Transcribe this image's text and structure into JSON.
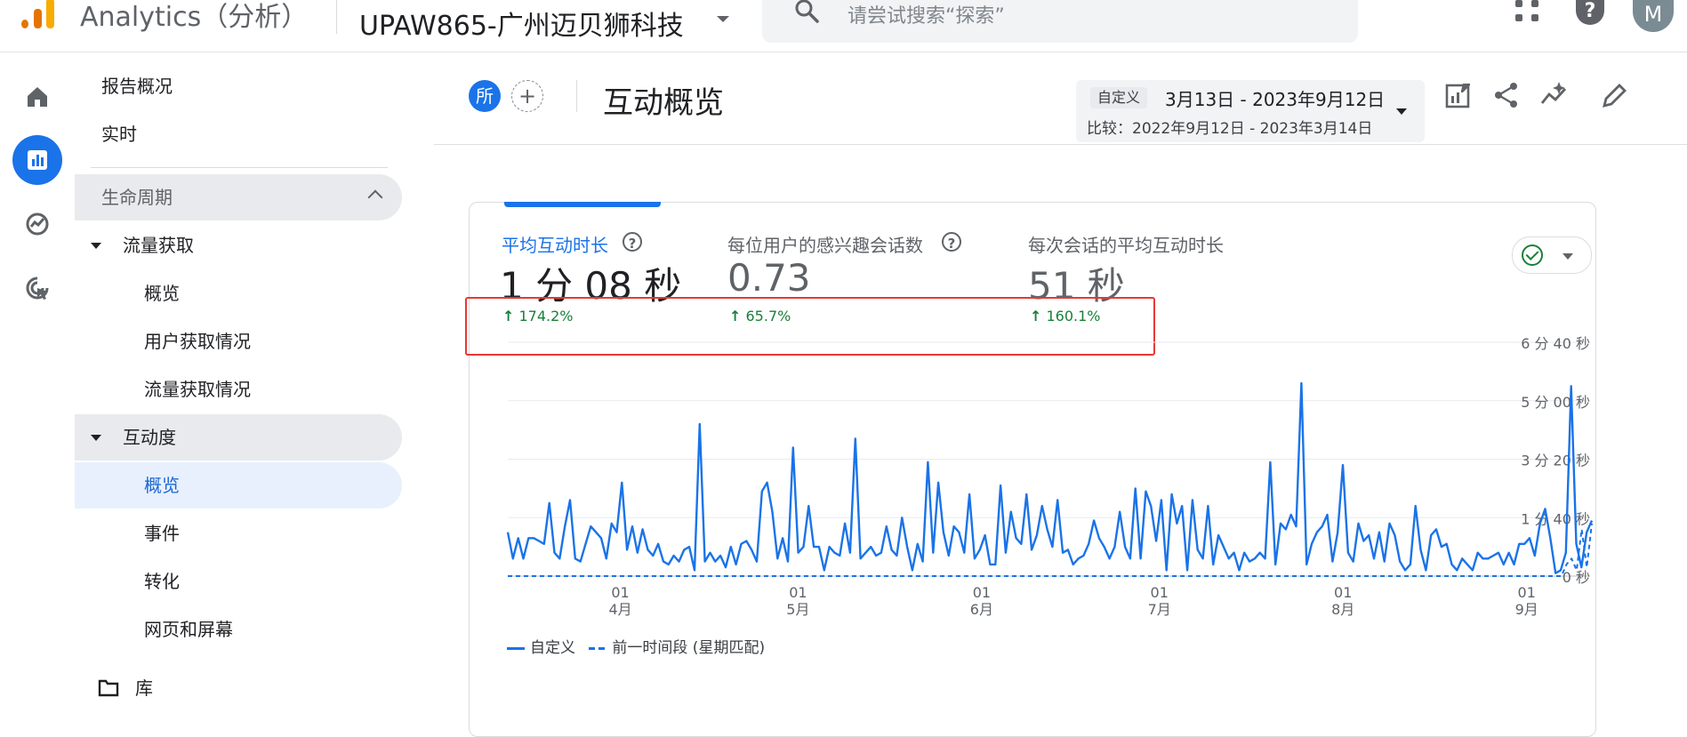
{
  "topbar": {
    "product": "Analytics（分析）",
    "account": "UPAW865-广州迈贝狮科技",
    "search_placeholder": "请尝试搜索“探索”",
    "help": "?",
    "avatar": "M"
  },
  "rail": {
    "items": [
      {
        "icon": "home-icon",
        "active": false
      },
      {
        "icon": "reports-icon",
        "active": true
      },
      {
        "icon": "explore-icon",
        "active": false
      },
      {
        "icon": "advertising-icon",
        "active": false
      }
    ]
  },
  "nav": {
    "items": [
      {
        "label": "报告概况"
      },
      {
        "label": "实时"
      },
      {
        "label": "生命周期"
      },
      {
        "label": "流量获取"
      },
      {
        "label": "概览"
      },
      {
        "label": "用户获取情况"
      },
      {
        "label": "流量获取情况"
      },
      {
        "label": "互动度"
      },
      {
        "label": "概览"
      },
      {
        "label": "事件"
      },
      {
        "label": "转化"
      },
      {
        "label": "网页和屏幕"
      },
      {
        "label": "库"
      }
    ]
  },
  "header": {
    "chip": "所",
    "add": "+",
    "title": "互动概览",
    "date_tag": "自定义",
    "date_range": "3月13日 - 2023年9月12日",
    "compare": "比较：2022年9月12日 - 2023年3月14日"
  },
  "metrics": [
    {
      "label": "平均互动时长",
      "value": "1 分 08 秒",
      "change": "174.2%"
    },
    {
      "label": "每位用户的感兴趣会话数",
      "value": "0.73",
      "change": "65.7%"
    },
    {
      "label": "每次会话的平均互动时长",
      "value": "51 秒",
      "change": "160.1%"
    }
  ],
  "arrow_up": "↑",
  "chart_data": {
    "type": "line",
    "y_tick_labels": [
      "0 秒",
      "1 分 40 秒",
      "3 分 20 秒",
      "5 分 00 秒",
      "6 分 40 秒"
    ],
    "y_ticks_seconds": [
      0,
      100,
      200,
      300,
      400
    ],
    "ylim": [
      0,
      400
    ],
    "x_tick_labels": [
      {
        "day": "01",
        "month": "4月"
      },
      {
        "day": "01",
        "month": "5月"
      },
      {
        "day": "01",
        "month": "6月"
      },
      {
        "day": "01",
        "month": "7月"
      },
      {
        "day": "01",
        "month": "8月"
      },
      {
        "day": "01",
        "month": "9月"
      }
    ],
    "x_start": "2023-03-13",
    "x_end": "2023-09-12",
    "grid": true,
    "legend_position": "bottom-left",
    "series": [
      {
        "name": "自定义",
        "style": "solid",
        "color": "#1a73e8",
        "values": [
          75,
          30,
          65,
          30,
          65,
          65,
          60,
          55,
          125,
          40,
          30,
          85,
          130,
          30,
          25,
          55,
          85,
          75,
          65,
          30,
          90,
          75,
          160,
          45,
          85,
          40,
          80,
          45,
          35,
          55,
          25,
          20,
          35,
          25,
          45,
          50,
          10,
          260,
          25,
          40,
          25,
          35,
          15,
          50,
          20,
          55,
          60,
          45,
          25,
          145,
          160,
          110,
          30,
          65,
          25,
          220,
          40,
          50,
          120,
          50,
          50,
          10,
          50,
          40,
          35,
          90,
          40,
          235,
          30,
          40,
          50,
          35,
          40,
          85,
          45,
          35,
          100,
          50,
          10,
          55,
          25,
          195,
          40,
          160,
          75,
          35,
          85,
          75,
          40,
          140,
          30,
          45,
          70,
          20,
          20,
          155,
          40,
          110,
          65,
          55,
          140,
          45,
          70,
          120,
          80,
          50,
          130,
          40,
          45,
          20,
          30,
          35,
          55,
          95,
          65,
          50,
          30,
          50,
          110,
          50,
          30,
          150,
          30,
          145,
          120,
          60,
          130,
          10,
          140,
          90,
          120,
          10,
          130,
          45,
          30,
          120,
          20,
          70,
          50,
          30,
          40,
          10,
          40,
          25,
          30,
          40,
          30,
          195,
          20,
          90,
          80,
          105,
          85,
          330,
          20,
          55,
          75,
          85,
          105,
          25,
          75,
          190,
          40,
          25,
          90,
          60,
          70,
          30,
          75,
          25,
          90,
          70,
          25,
          10,
          20,
          120,
          45,
          10,
          70,
          80,
          50,
          55,
          20,
          10,
          30,
          20,
          10,
          40,
          30,
          30,
          35,
          40,
          20,
          40,
          20,
          55,
          55,
          65,
          35,
          90,
          115,
          65,
          5,
          10,
          40,
          325,
          55,
          15,
          75,
          95
        ]
      },
      {
        "name": "前一时间段 (星期匹配)",
        "style": "dashed",
        "color": "#1a73e8",
        "values": [
          0,
          0,
          0,
          0,
          0,
          0,
          0,
          0,
          0,
          0,
          0,
          0,
          0,
          0,
          0,
          0,
          0,
          0,
          0,
          0,
          0,
          0,
          0,
          0,
          0,
          0,
          0,
          0,
          0,
          0,
          0,
          0,
          0,
          0,
          0,
          0,
          0,
          0,
          0,
          0,
          0,
          0,
          0,
          0,
          0,
          0,
          0,
          0,
          0,
          0,
          0,
          0,
          0,
          0,
          0,
          0,
          0,
          0,
          0,
          0,
          0,
          0,
          0,
          0,
          0,
          0,
          0,
          0,
          0,
          0,
          0,
          0,
          0,
          0,
          0,
          0,
          0,
          0,
          0,
          0,
          0,
          0,
          0,
          0,
          0,
          0,
          0,
          0,
          0,
          0,
          0,
          0,
          0,
          0,
          0,
          0,
          0,
          0,
          0,
          0,
          0,
          0,
          0,
          0,
          0,
          0,
          0,
          0,
          0,
          0,
          0,
          0,
          0,
          0,
          0,
          0,
          0,
          0,
          0,
          0,
          0,
          0,
          0,
          0,
          0,
          0,
          0,
          0,
          0,
          0,
          0,
          0,
          0,
          0,
          0,
          0,
          0,
          0,
          0,
          0,
          0,
          0,
          0,
          0,
          0,
          0,
          0,
          0,
          0,
          0,
          0,
          0,
          0,
          0,
          0,
          0,
          0,
          0,
          0,
          0,
          0,
          0,
          0,
          0,
          0,
          0,
          0,
          0,
          0,
          0,
          0,
          0,
          0,
          0,
          0,
          0,
          0,
          0,
          0,
          0,
          0,
          0,
          0,
          0,
          0,
          0,
          0,
          0,
          0,
          0,
          0,
          0,
          0,
          0,
          0,
          0,
          0,
          0,
          0,
          0,
          0,
          0,
          0,
          0,
          0,
          0,
          0,
          0,
          0,
          20,
          30,
          10,
          80,
          15,
          90
        ]
      }
    ]
  }
}
